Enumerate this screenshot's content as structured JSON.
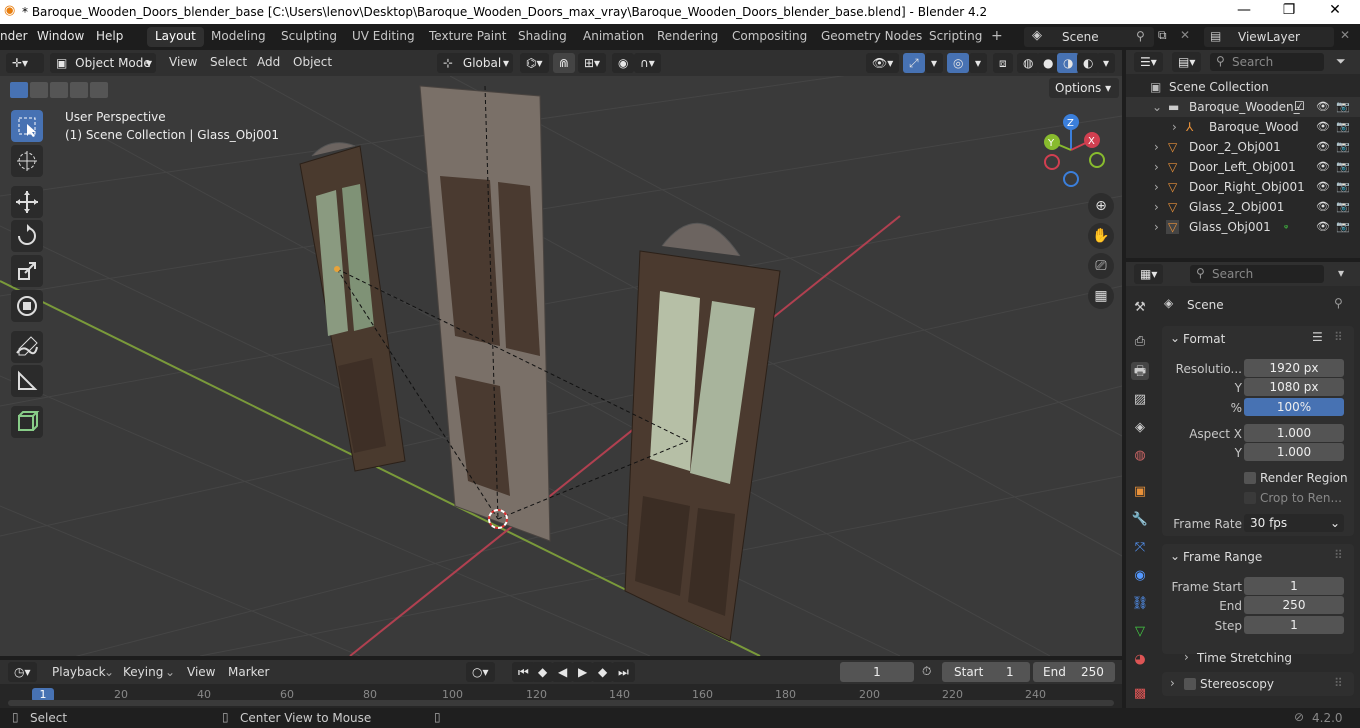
{
  "window": {
    "title": "* Baroque_Wooden_Doors_blender_base [C:\\Users\\lenov\\Desktop\\Baroque_Wooden_Doors_max_vray\\Baroque_Wooden_Doors_blender_base.blend] - Blender 4.2",
    "minimize": "—",
    "maximize": "❐",
    "close": "✕"
  },
  "menubar": {
    "items": [
      "nder",
      "Window",
      "Help"
    ]
  },
  "workspaces": [
    "Layout",
    "Modeling",
    "Sculpting",
    "UV Editing",
    "Texture Paint",
    "Shading",
    "Animation",
    "Rendering",
    "Compositing",
    "Geometry Nodes",
    "Scripting"
  ],
  "workspace_add": "+",
  "scene": {
    "name": "Scene",
    "view_layer": "ViewLayer"
  },
  "viewport_header": {
    "mode": "Object Mode",
    "menus": [
      "View",
      "Select",
      "Add",
      "Object"
    ],
    "transform": "Global",
    "options": "Options"
  },
  "viewport": {
    "perspective": "User Perspective",
    "collection_info": "(1) Scene Collection | Glass_Obj001",
    "gizmo": {
      "x": "X",
      "y": "Y",
      "z": "Z"
    },
    "colors": {
      "x": "#d13f50",
      "y": "#88bb2e",
      "z": "#3b7fdb",
      "grid": "#444444",
      "bg": "#3a3a3a"
    }
  },
  "outliner": {
    "search_placeholder": "Search",
    "root": "Scene Collection",
    "items": [
      {
        "label": "Baroque_Wooden_",
        "indent": 1
      },
      {
        "label": "Baroque_Wood",
        "indent": 2
      },
      {
        "label": "Door_2_Obj001",
        "indent": 1
      },
      {
        "label": "Door_Left_Obj001",
        "indent": 1
      },
      {
        "label": "Door_Right_Obj001",
        "indent": 1
      },
      {
        "label": "Glass_2_Obj001",
        "indent": 1
      },
      {
        "label": "Glass_Obj001",
        "indent": 1
      }
    ]
  },
  "properties": {
    "search_placeholder": "Search",
    "context": "Scene",
    "format": {
      "title": "Format",
      "resolution_label": "Resolutio...",
      "resolution_x": "1920 px",
      "y_label": "Y",
      "resolution_y": "1080 px",
      "pct_label": "%",
      "resolution_pct": "100%",
      "aspect_label": "Aspect X",
      "aspect_x": "1.000",
      "aspect_y_label": "Y",
      "aspect_y": "1.000",
      "render_region": "Render Region",
      "crop": "Crop to Ren...",
      "frame_rate_label": "Frame Rate",
      "frame_rate": "30 fps"
    },
    "frame_range": {
      "title": "Frame Range",
      "start_label": "Frame Start",
      "start": "1",
      "end_label": "End",
      "end": "250",
      "step_label": "Step",
      "step": "1"
    },
    "time_stretching": "Time Stretching",
    "stereoscopy": "Stereoscopy"
  },
  "timeline": {
    "menus": [
      "Playback",
      "Keying",
      "View",
      "Marker"
    ],
    "current_frame": "1",
    "start_label": "Start",
    "start": "1",
    "end_label": "End",
    "end": "250",
    "ticks": [
      "1",
      "20",
      "40",
      "60",
      "80",
      "100",
      "120",
      "140",
      "160",
      "180",
      "200",
      "220",
      "240"
    ]
  },
  "statusbar": {
    "select": "Select",
    "center": "Center View to Mouse",
    "version": "4.2.0"
  }
}
